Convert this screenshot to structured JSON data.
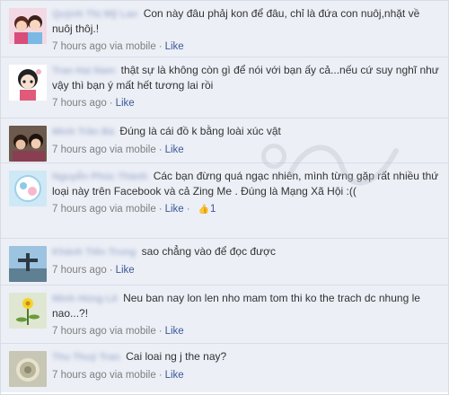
{
  "comments": [
    {
      "author": "Quỳnh Thị Mỹ Lan",
      "text": "Con này đâu phảj kon để đâu, chỉ là đứa con nuôj,nhặt về nuôj thôj.!",
      "time": "7 hours ago",
      "via": "via mobile",
      "like": "Like"
    },
    {
      "author": "Tran Hai Nam",
      "text": "thật sự là không còn gì để nói với bạn ấy cả...nếu cứ suy nghĩ như vậy thì bạn ý mất hết tương lai rồi",
      "time": "7 hours ago",
      "like": "Like"
    },
    {
      "author": "Minh Trần Bà",
      "text": "Đúng là cái đồ k bằng loài xúc vật",
      "time": "7 hours ago",
      "via": "via mobile",
      "like": "Like"
    },
    {
      "author": "Nguyễn Phúc Thành",
      "text": "Các bạn đừng quá ngạc nhiên, mình từng gặp rất nhiều thứ loại này trên Facebook và cả Zing Me . Đúng là Mạng Xã Hội :((",
      "time": "7 hours ago",
      "via": "via mobile",
      "like": "Like",
      "like_count": "1"
    },
    {
      "author": "Khánh Tiến Trung",
      "text": "sao chẳng vào để đọc được",
      "time": "7 hours ago",
      "like": "Like"
    },
    {
      "author": "Minh Hùng Lê",
      "text": "Neu ban nay lon len nho mam tom thi ko the trach dc nhung le nao...?!",
      "time": "7 hours ago",
      "via": "via mobile",
      "like": "Like"
    },
    {
      "author": "Thu Thuý Tran",
      "text": "Cai loai ng j the nay?",
      "time": "7 hours ago",
      "via": "via mobile",
      "like": "Like"
    }
  ],
  "icons": {
    "like_count": "thumbs-up-icon"
  },
  "colors": {
    "background": "#eceff6",
    "link": "#3b5998",
    "meta": "#7f7f7f"
  }
}
